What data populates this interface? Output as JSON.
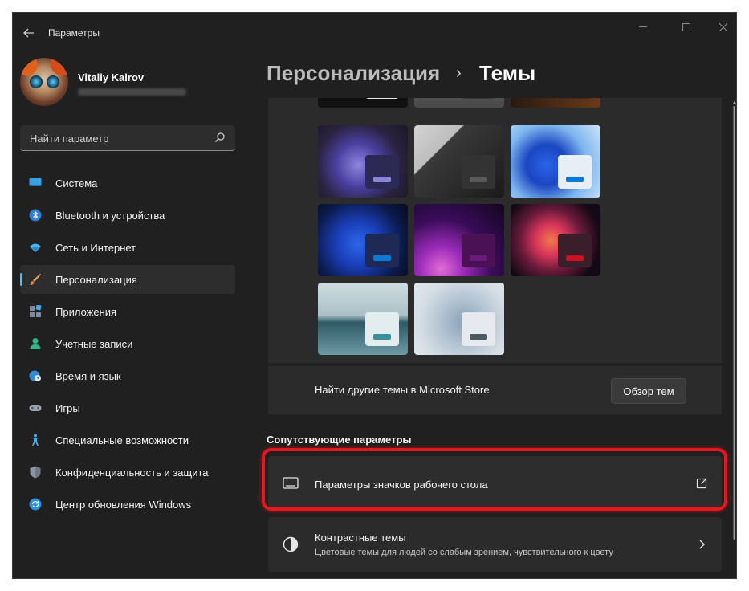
{
  "window": {
    "app_title": "Параметры",
    "controls": {
      "minimize": "—",
      "maximize": "☐",
      "close": "✕"
    }
  },
  "user": {
    "name": "Vitaliy Kairov"
  },
  "search": {
    "placeholder": "Найти параметр"
  },
  "sidebar": {
    "items": [
      {
        "id": "system",
        "label": "Система",
        "icon": "monitor-icon",
        "active": false
      },
      {
        "id": "bluetooth",
        "label": "Bluetooth и устройства",
        "icon": "bluetooth-icon",
        "active": false
      },
      {
        "id": "network",
        "label": "Сеть и Интернет",
        "icon": "wifi-icon",
        "active": false
      },
      {
        "id": "personalization",
        "label": "Персонализация",
        "icon": "brush-icon",
        "active": true
      },
      {
        "id": "apps",
        "label": "Приложения",
        "icon": "apps-icon",
        "active": false
      },
      {
        "id": "accounts",
        "label": "Учетные записи",
        "icon": "person-icon",
        "active": false
      },
      {
        "id": "time-language",
        "label": "Время и язык",
        "icon": "globe-clock-icon",
        "active": false
      },
      {
        "id": "gaming",
        "label": "Игры",
        "icon": "gamepad-icon",
        "active": false
      },
      {
        "id": "accessibility",
        "label": "Специальные возможности",
        "icon": "accessibility-icon",
        "active": false
      },
      {
        "id": "privacy",
        "label": "Конфиденциальность и защита",
        "icon": "shield-icon",
        "active": false
      },
      {
        "id": "windows-update",
        "label": "Центр обновления Windows",
        "icon": "update-icon",
        "active": false
      }
    ]
  },
  "header": {
    "parent": "Персонализация",
    "separator": "›",
    "current": "Темы"
  },
  "themes": {
    "tiles": [
      {
        "name": "windows-dark-bloom",
        "accent": "#8a83d8"
      },
      {
        "name": "xbox",
        "accent": "#5a5a5a"
      },
      {
        "name": "windows-light-bloom",
        "accent": "#0b7ad6"
      },
      {
        "name": "windows-dark-blue",
        "accent": "#0b7ad6"
      },
      {
        "name": "glow",
        "accent": "#6a1a7a"
      },
      {
        "name": "captured-motion",
        "accent": "#cc1222"
      },
      {
        "name": "sunrise",
        "accent": "#3b8f9d"
      },
      {
        "name": "flow",
        "accent": "#4c5a63"
      }
    ],
    "store_label": "Найти другие темы в Microsoft Store",
    "browse_button": "Обзор тем"
  },
  "related": {
    "title": "Сопутствующие параметры",
    "desktop_icons": {
      "title": "Параметры значков рабочего стола",
      "icon": "desktop-icon",
      "action_icon": "external-link-icon"
    },
    "contrast": {
      "title": "Контрастные темы",
      "description": "Цветовые темы для людей со слабым зрением, чувствительного к цвету",
      "icon": "contrast-icon",
      "action_icon": "chevron-right-icon"
    }
  },
  "colors": {
    "accent": "#4cc2ff",
    "highlight": "#e8161e",
    "background": "#202020",
    "card": "#2b2b2b"
  }
}
